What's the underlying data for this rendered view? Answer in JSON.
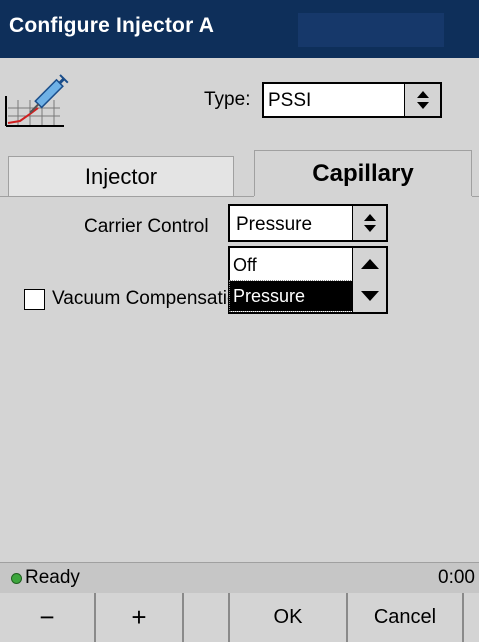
{
  "window": {
    "title": "Configure Injector A"
  },
  "header": {
    "type_label": "Type:",
    "type_value": "PSSI",
    "icon": "syringe-chart-icon"
  },
  "tabs": [
    {
      "label": "Injector",
      "active": false
    },
    {
      "label": "Capillary",
      "active": true
    }
  ],
  "carrier": {
    "label": "Carrier Control",
    "value": "Pressure",
    "options": [
      "Off",
      "Pressure"
    ],
    "highlighted": "Pressure"
  },
  "vacuum": {
    "label": "Vacuum Compensation",
    "checked": false
  },
  "status": {
    "text": "Ready",
    "time": "0:00",
    "indicator_color": "#3da63d"
  },
  "buttons": {
    "minus": "−",
    "plus": "+",
    "ok": "OK",
    "cancel": "Cancel"
  },
  "colors": {
    "title_bar": "#0e2f5a",
    "background": "#d4d4d4"
  }
}
